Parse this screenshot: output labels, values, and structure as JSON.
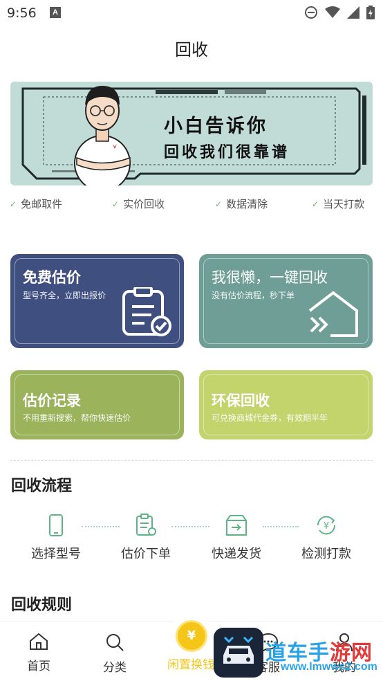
{
  "status_bar": {
    "time": "9:56",
    "notification_letter": "A"
  },
  "header": {
    "title": "回收"
  },
  "banner": {
    "line1": "小白告诉你",
    "line2": "回收我们很靠谱"
  },
  "features": [
    "免邮取件",
    "实价回收",
    "数据清除",
    "当天打款"
  ],
  "cards": {
    "free_estimate": {
      "title": "免费估价",
      "subtitle": "型号齐全，立即出报价",
      "color": "#3f4f80"
    },
    "one_click": {
      "title": "我很懒，一键回收",
      "subtitle": "没有估价流程，秒下单",
      "color": "#6e9e96"
    },
    "history": {
      "title": "估价记录",
      "subtitle": "不用重新搜索，帮你快速估价",
      "color": "#9bb35a"
    },
    "eco": {
      "title": "环保回收",
      "subtitle": "可兑换商城代金券，有效期半年",
      "color": "#c3d46d"
    }
  },
  "process": {
    "title": "回收流程",
    "steps": [
      "选择型号",
      "估价下单",
      "快递发货",
      "检测打款"
    ]
  },
  "rules": {
    "title": "回收规则"
  },
  "bottom_nav": {
    "items": [
      "首页",
      "分类",
      "闲置换钱",
      "客服",
      "我的"
    ],
    "coin_symbol": "¥"
  },
  "watermark": {
    "text_part1": "道车手",
    "text_part2": "游网",
    "url": "www.lmwws2.com"
  },
  "accent_color": "#6ab07a"
}
